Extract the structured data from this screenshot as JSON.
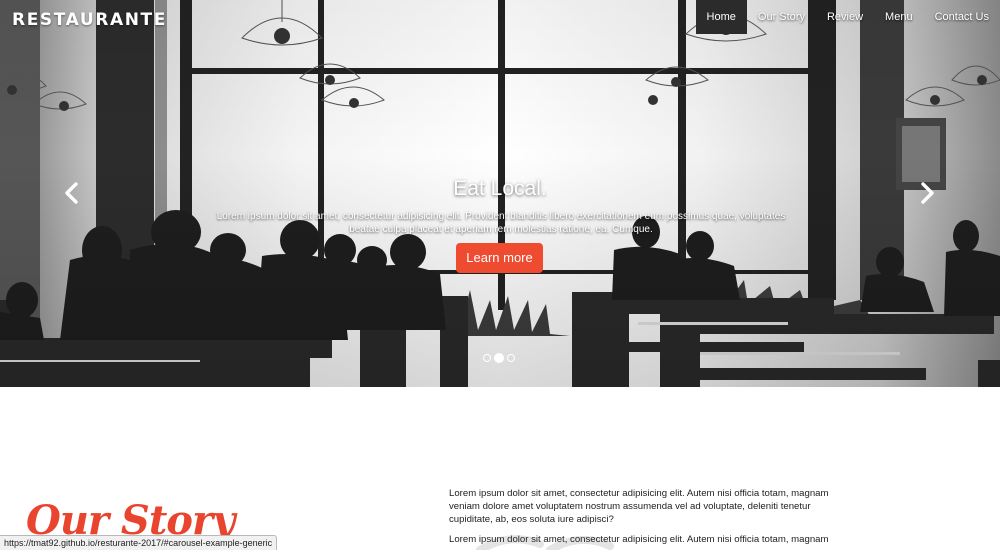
{
  "brand": {
    "name": "RESTAURANTE"
  },
  "nav": {
    "items": [
      {
        "label": "Home",
        "active": true
      },
      {
        "label": "Our Story",
        "active": false
      },
      {
        "label": "Review",
        "active": false
      },
      {
        "label": "Menu",
        "active": false
      },
      {
        "label": "Contact Us",
        "active": false
      }
    ]
  },
  "carousel": {
    "title": "Eat Local.",
    "text": "Lorem ipsum dolor sit amet, consectetur adipisicing elit. Provident blanditis libero exercitationem eum possimus quae, voluptates beatae culpa placeat et aperiam rem molestias ratione, ea. Cumque.",
    "button_label": "Learn more",
    "prev_icon": "chevron-left-icon",
    "next_icon": "chevron-right-icon",
    "slides": 3,
    "active_slide": 2
  },
  "story": {
    "heading": "Our Story",
    "para1": "Lorem ipsum dolor sit amet, consectetur adipisicing elit. Autem nisi officia totam, magnam veniam dolore amet voluptatem nostrum assumenda vel ad voluptate, deleniti tenetur cupiditate, ab, eos soluta iure adipisci?",
    "para2": "Lorem ipsum dolor sit amet, consectetur adipisicing elit. Autem nisi officia totam, magnam"
  },
  "status_bar": {
    "url": "https://tmat92.github.io/resturante-2017/#carousel-example-generic"
  },
  "colors": {
    "accent": "#ef4b31",
    "heading": "#e8442e",
    "nav_active": "#2b2b2b"
  }
}
